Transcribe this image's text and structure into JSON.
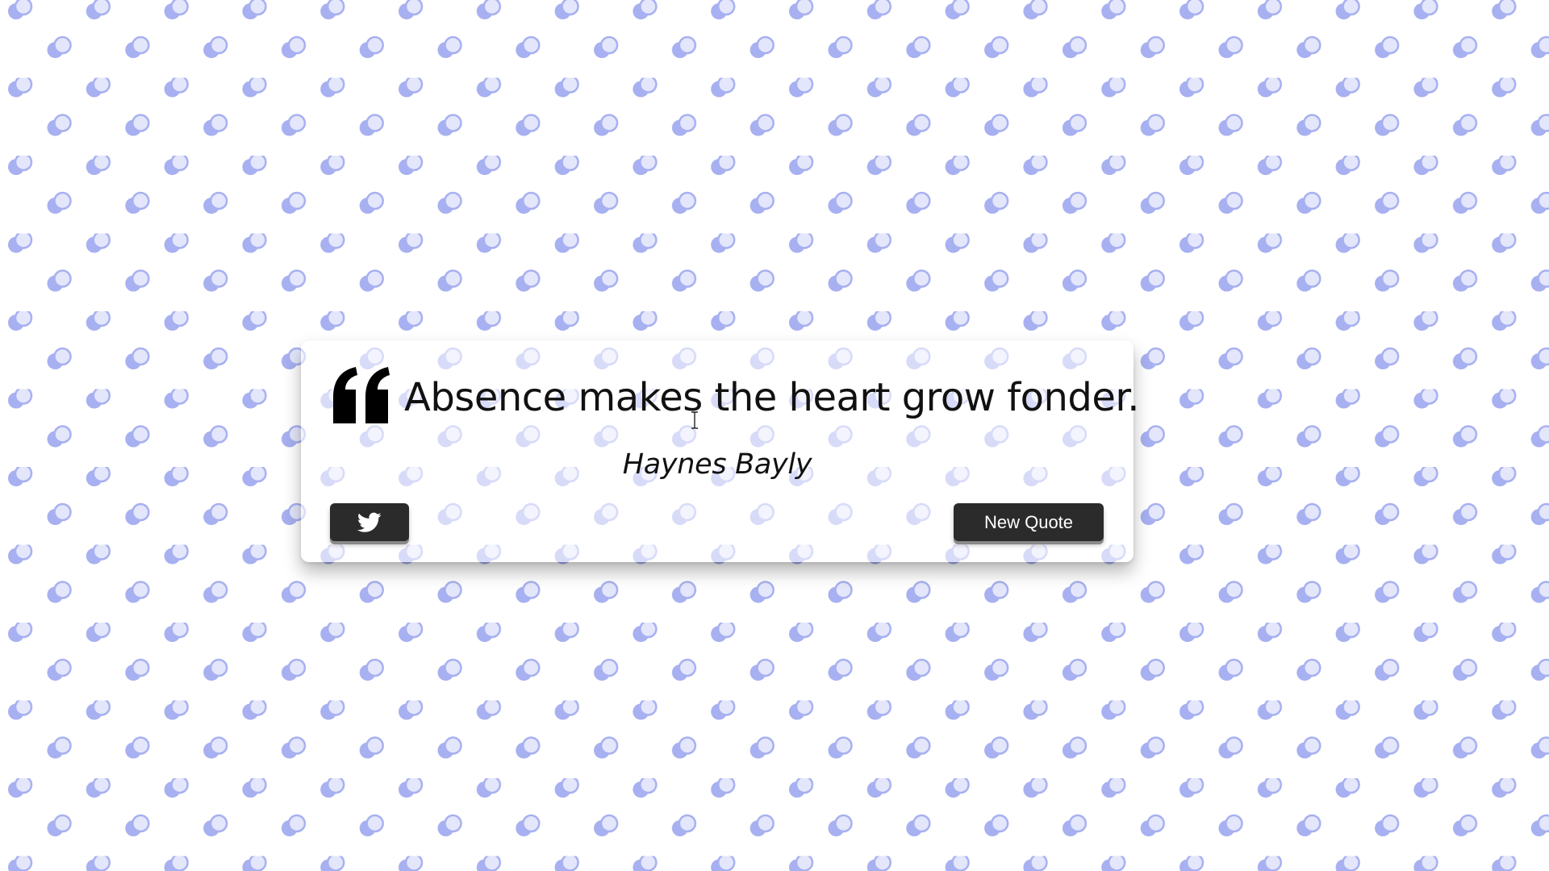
{
  "background": {
    "pattern": "overlapping-circles",
    "colors": {
      "base": "#ffffff",
      "dot_dark": "#a6aff0",
      "dot_light": "#d4d8f7"
    }
  },
  "quote": {
    "icon": "quote-left-icon",
    "text": "Absence makes the heart grow fonder.",
    "author": "Haynes Bayly"
  },
  "actions": {
    "twitter_icon": "twitter-icon",
    "new_quote_label": "New Quote",
    "button_color": "#2b2b2b"
  }
}
